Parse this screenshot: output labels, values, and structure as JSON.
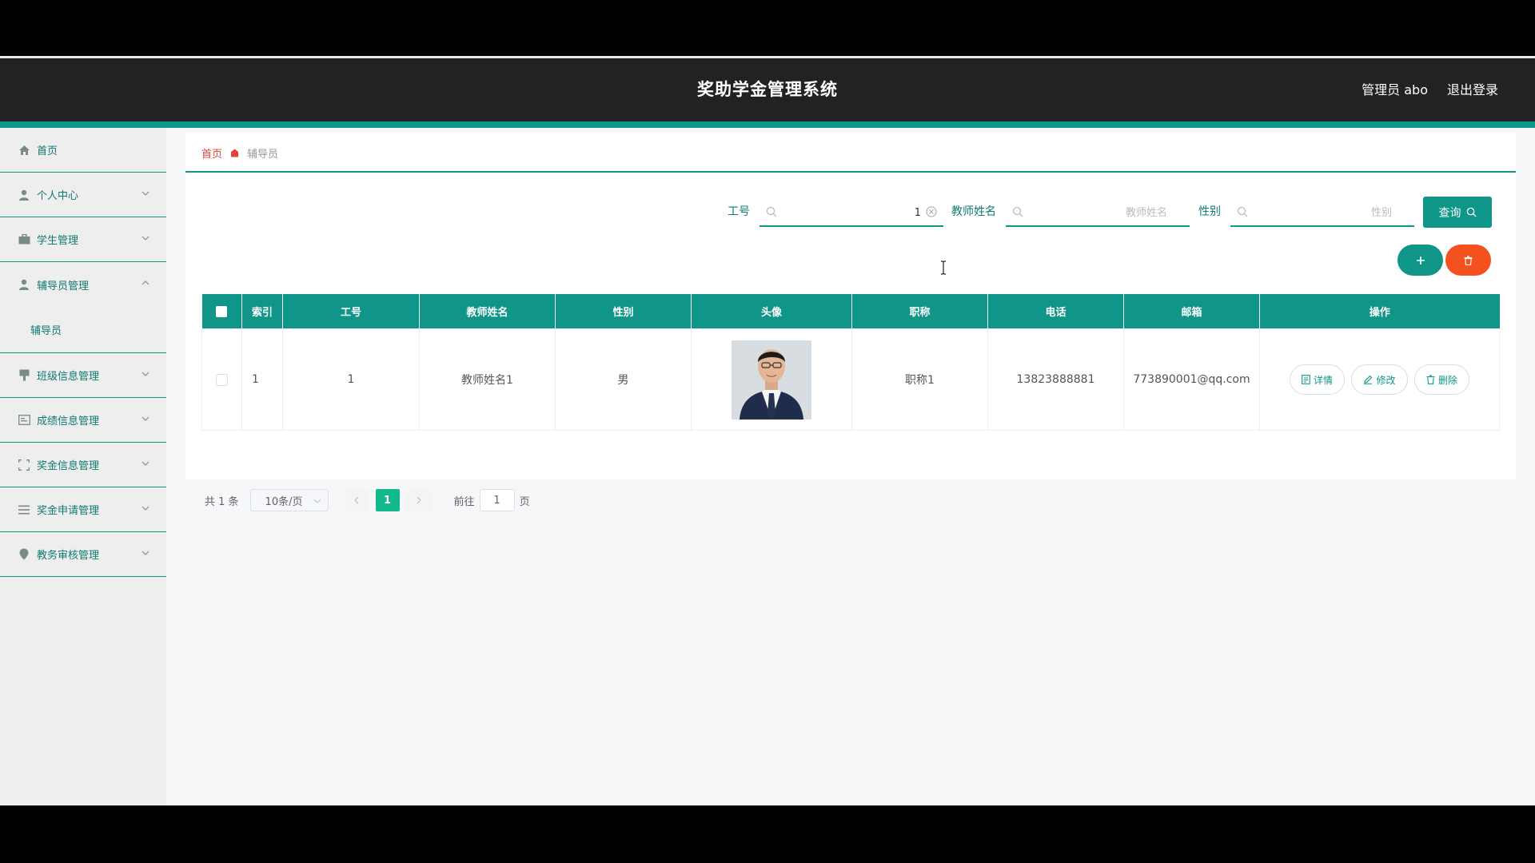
{
  "header": {
    "title": "奖助学金管理系统",
    "user": "管理员 abo",
    "logout": "退出登录"
  },
  "sidebar": {
    "items": [
      {
        "label": "首页",
        "icon": "home-icon"
      },
      {
        "label": "个人中心",
        "icon": "user-icon"
      },
      {
        "label": "学生管理",
        "icon": "briefcase-icon"
      },
      {
        "label": "辅导员管理",
        "icon": "user-icon",
        "expanded": true,
        "children": [
          {
            "label": "辅导员"
          }
        ]
      },
      {
        "label": "班级信息管理",
        "icon": "tag-icon"
      },
      {
        "label": "成绩信息管理",
        "icon": "card-icon"
      },
      {
        "label": "奖金信息管理",
        "icon": "frame-icon"
      },
      {
        "label": "奖金申请管理",
        "icon": "list-icon"
      },
      {
        "label": "教务审核管理",
        "icon": "pin-icon"
      }
    ]
  },
  "breadcrumb": {
    "home": "首页",
    "current": "辅导员"
  },
  "search": {
    "field1": {
      "label": "工号",
      "value": "1"
    },
    "field2": {
      "label": "教师姓名",
      "placeholder": "教师姓名"
    },
    "field3": {
      "label": "性别",
      "placeholder": "性别"
    },
    "query_label": "查询"
  },
  "table": {
    "columns": [
      "索引",
      "工号",
      "教师姓名",
      "性别",
      "头像",
      "职称",
      "电话",
      "邮箱",
      "操作"
    ],
    "rows": [
      {
        "index": "1",
        "id": "1",
        "name": "教师姓名1",
        "gender": "男",
        "title": "职称1",
        "phone": "13823888881",
        "email": "773890001@qq.com"
      }
    ],
    "actions": {
      "detail": "详情",
      "edit": "修改",
      "delete": "删除"
    }
  },
  "pagination": {
    "total": "共 1 条",
    "page_size": "10条/页",
    "current_page": "1",
    "goto_label": "前往",
    "goto_value": "1",
    "page_unit": "页"
  },
  "colors": {
    "accent": "#0f9688",
    "header_bg": "#222222",
    "danger": "#f4511e",
    "breadcrumb_home": "#e0443a",
    "page_active": "#13b98d"
  }
}
